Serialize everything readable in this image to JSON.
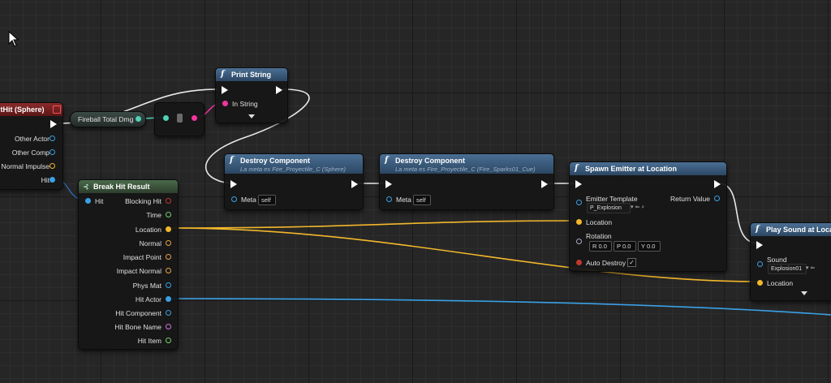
{
  "on_hit": {
    "title": "ntHit (Sphere)",
    "outputs": [
      "Other Actor",
      "Other Comp",
      "Normal Impulse",
      "Hit"
    ]
  },
  "fireball_var": {
    "label": "Fireball Total Dmg"
  },
  "print_string": {
    "title": "Print String",
    "input": "In String"
  },
  "destroy1": {
    "title": "Destroy Component",
    "subtitle": "La meta es Fire_Proyectile_C (Sphere)",
    "target_label": "Meta",
    "target_value": "self"
  },
  "destroy2": {
    "title": "Destroy Component",
    "subtitle": "La meta es Fire_Proyectile_C (Fire_Sparks01_Cue)",
    "target_label": "Meta",
    "target_value": "self"
  },
  "break_hit": {
    "title": "Break Hit Result",
    "input": "Hit",
    "outputs": [
      "Blocking Hit",
      "Time",
      "Location",
      "Normal",
      "Impact Point",
      "Impact Normal",
      "Phys Mat",
      "Hit Actor",
      "Hit Component",
      "Hit Bone Name",
      "Hit Item"
    ]
  },
  "spawn_emitter": {
    "title": "Spawn Emitter at Location",
    "emitter_label": "Emitter Template",
    "emitter_value": "P_Explosion",
    "return_label": "Return Value",
    "location_label": "Location",
    "rotation_label": "Rotation",
    "rotation": {
      "r_label": "R",
      "r": "0.0",
      "p_label": "P",
      "p": "0.0",
      "y_label": "Y",
      "y": "0.0"
    },
    "auto_destroy_label": "Auto Destroy",
    "auto_destroy_check": "✓"
  },
  "play_sound": {
    "title": "Play Sound at Location",
    "sound_label": "Sound",
    "sound_value": "Explosion01",
    "location_label": "Location"
  }
}
